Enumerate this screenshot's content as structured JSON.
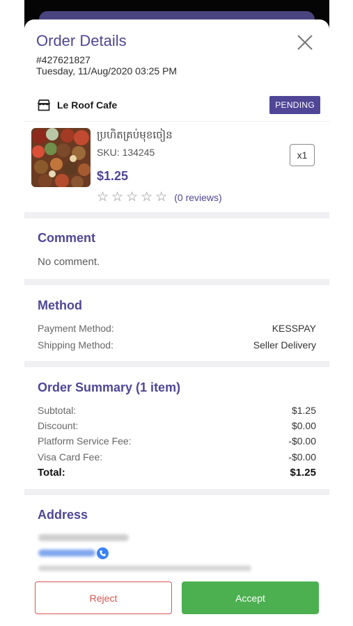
{
  "header": {
    "title": "Order Details",
    "order_id": "#427621827",
    "order_date": "Tuesday, 11/Aug/2020 03:25 PM"
  },
  "shop": {
    "name": "Le Roof Cafe",
    "status": "PENDING"
  },
  "product": {
    "name": "ប្រហិតគ្រប់មុខចៀន",
    "sku": "SKU: 134245",
    "price": "$1.25",
    "stars": [
      "☆",
      "☆",
      "☆",
      "☆",
      "☆"
    ],
    "reviews": "(0 reviews)",
    "quantity": "x1"
  },
  "comment": {
    "title": "Comment",
    "text": "No comment."
  },
  "method": {
    "title": "Method",
    "payment_label": "Payment Method:",
    "payment_value": "KESSPAY",
    "shipping_label": "Shipping Method:",
    "shipping_value": "Seller Delivery"
  },
  "summary": {
    "title": "Order Summary (1 item)",
    "subtotal_label": "Subtotal:",
    "subtotal_value": "$1.25",
    "discount_label": "Discount:",
    "discount_value": "$0.00",
    "platform_fee_label": "Platform Service Fee:",
    "platform_fee_value": "-$0.00",
    "visa_fee_label": "Visa Card Fee:",
    "visa_fee_value": "-$0.00",
    "total_label": "Total:",
    "total_value": "$1.25"
  },
  "address": {
    "title": "Address"
  },
  "actions": {
    "reject": "Reject",
    "accept": "Accept"
  },
  "colors": {
    "accent": "#4f4696",
    "reject": "#d9534f",
    "accept": "#4caf50"
  },
  "icons": [
    "close-icon",
    "shop-icon",
    "star-icon",
    "phone-icon"
  ]
}
